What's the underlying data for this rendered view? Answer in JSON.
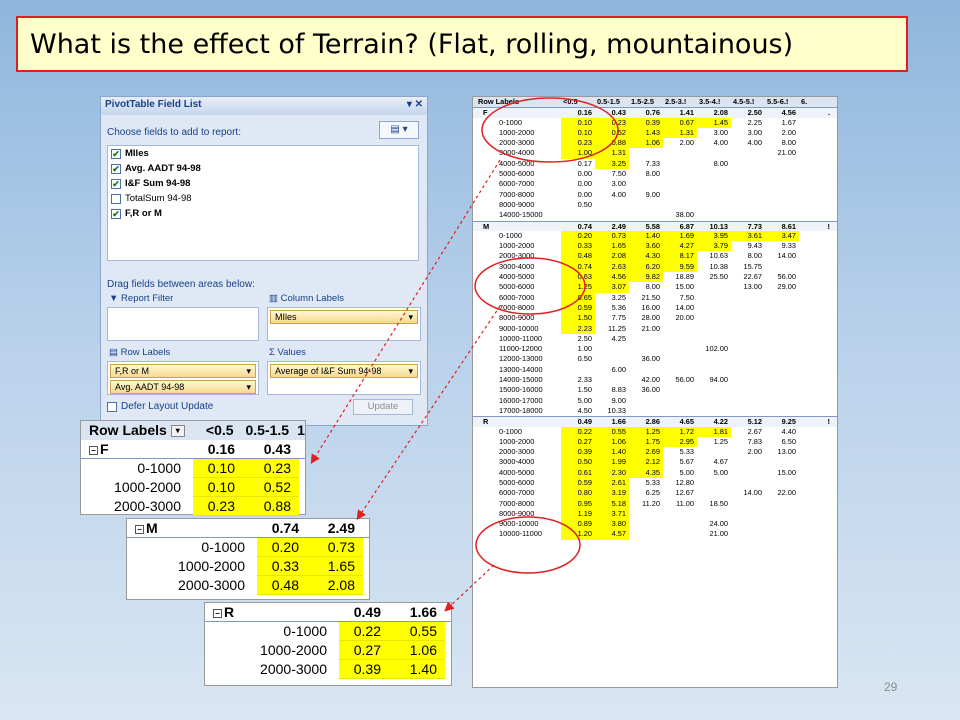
{
  "title": "What is the effect of Terrain? (Flat, rolling, mountainous)",
  "slide_number": "29",
  "field_list": {
    "header": "PivotTable Field List",
    "choose_label": "Choose fields to add to report:",
    "fields": [
      {
        "label": "MIles",
        "checked": "✔"
      },
      {
        "label": "Avg. AADT 94-98",
        "checked": "✔"
      },
      {
        "label": "I&F Sum 94-98",
        "checked": "✔"
      },
      {
        "label": "TotalSum 94-98",
        "checked": ""
      },
      {
        "label": "F,R or M",
        "checked": "✔"
      }
    ],
    "drag_label": "Drag fields between areas below:",
    "report_filter": "Report Filter",
    "column_labels": "Column Labels",
    "column_field": "MIles",
    "row_labels": "Row Labels",
    "values": "Values",
    "row_fields": [
      "F,R or M",
      "Avg. AADT 94-98"
    ],
    "value_field": "Average of I&F Sum 94-98",
    "defer_label": "Defer Layout Update",
    "update_label": "Update"
  },
  "big_table": {
    "header": [
      "Row Labels",
      "<0.5",
      "0.5-1.5",
      "1.5-2.5",
      "2.5-3.!",
      "3.5-4.!",
      "4.5-5.!",
      "5.5-6.!",
      "6."
    ],
    "rows": [
      {
        "label": "F",
        "type": "group",
        "cells": [
          "0.16",
          "0.43",
          "0.76",
          "1.41",
          "2.08",
          "2.50",
          "4.56",
          "."
        ],
        "yellow": [
          0,
          0,
          0,
          0,
          0,
          0,
          0,
          0
        ]
      },
      {
        "label": "0-1000",
        "type": "item",
        "cells": [
          "0.10",
          "0.23",
          "0.39",
          "0.67",
          "1.45",
          "2.25",
          "1.67",
          ""
        ],
        "yellow": [
          1,
          1,
          1,
          1,
          1,
          0,
          0,
          0
        ]
      },
      {
        "label": "1000-2000",
        "type": "item",
        "cells": [
          "0.10",
          "0.52",
          "1.43",
          "1.31",
          "3.00",
          "3.00",
          "2.00",
          ""
        ],
        "yellow": [
          1,
          1,
          1,
          1,
          0,
          0,
          0,
          0
        ]
      },
      {
        "label": "2000-3000",
        "type": "item",
        "cells": [
          "0.23",
          "0.88",
          "1.06",
          "2.00",
          "4.00",
          "4.00",
          "8.00",
          ""
        ],
        "yellow": [
          1,
          1,
          1,
          0,
          0,
          0,
          0,
          0
        ]
      },
      {
        "label": "3000-4000",
        "type": "item",
        "cells": [
          "1.00",
          "1.31",
          "",
          "",
          "",
          "",
          "21.00",
          ""
        ],
        "yellow": [
          1,
          1,
          0,
          0,
          0,
          0,
          0,
          0
        ]
      },
      {
        "label": "4000-5000",
        "type": "item",
        "cells": [
          "0.17",
          "3.25",
          "7.33",
          "",
          "8.00",
          "",
          "",
          ""
        ],
        "yellow": [
          0,
          1,
          0,
          0,
          0,
          0,
          0,
          0
        ]
      },
      {
        "label": "5000-6000",
        "type": "item",
        "cells": [
          "0.00",
          "7.50",
          "8.00",
          "",
          "",
          "",
          "",
          ""
        ],
        "yellow": [
          0,
          0,
          0,
          0,
          0,
          0,
          0,
          0
        ]
      },
      {
        "label": "6000-7000",
        "type": "item",
        "cells": [
          "0.00",
          "3.00",
          "",
          "",
          "",
          "",
          "",
          ""
        ],
        "yellow": [
          0,
          0,
          0,
          0,
          0,
          0,
          0,
          0
        ]
      },
      {
        "label": "7000-8000",
        "type": "item",
        "cells": [
          "0.00",
          "4.00",
          "9.00",
          "",
          "",
          "",
          "",
          ""
        ],
        "yellow": [
          0,
          0,
          0,
          0,
          0,
          0,
          0,
          0
        ]
      },
      {
        "label": "8000-9000",
        "type": "item",
        "cells": [
          "0.50",
          "",
          "",
          "",
          "",
          "",
          "",
          ""
        ],
        "yellow": [
          0,
          0,
          0,
          0,
          0,
          0,
          0,
          0
        ]
      },
      {
        "label": "14000-15000",
        "type": "item",
        "cells": [
          "",
          "",
          "",
          "38.00",
          "",
          "",
          "",
          ""
        ],
        "yellow": [
          0,
          0,
          0,
          0,
          0,
          0,
          0,
          0
        ]
      },
      {
        "label": "M",
        "type": "group",
        "cells": [
          "0.74",
          "2.49",
          "5.58",
          "6.87",
          "10.13",
          "7.73",
          "8.61",
          "!"
        ],
        "yellow": [
          0,
          0,
          0,
          0,
          0,
          0,
          0,
          0
        ]
      },
      {
        "label": "0-1000",
        "type": "item",
        "cells": [
          "0.20",
          "0.73",
          "1.40",
          "1.69",
          "3.95",
          "3.61",
          "3.47",
          ""
        ],
        "yellow": [
          1,
          1,
          1,
          1,
          1,
          1,
          1,
          0
        ]
      },
      {
        "label": "1000-2000",
        "type": "item",
        "cells": [
          "0.33",
          "1.65",
          "3.60",
          "4.27",
          "3.79",
          "9.43",
          "9.33",
          ""
        ],
        "yellow": [
          1,
          1,
          1,
          1,
          1,
          0,
          0,
          0
        ]
      },
      {
        "label": "2000-3000",
        "type": "item",
        "cells": [
          "0.48",
          "2.08",
          "4.30",
          "8.17",
          "10.63",
          "8.00",
          "14.00",
          ""
        ],
        "yellow": [
          1,
          1,
          1,
          1,
          0,
          0,
          0,
          0
        ]
      },
      {
        "label": "3000-4000",
        "type": "item",
        "cells": [
          "0.74",
          "2.63",
          "6.20",
          "9.59",
          "10.38",
          "15.75",
          "",
          ""
        ],
        "yellow": [
          1,
          1,
          1,
          1,
          0,
          0,
          0,
          0
        ]
      },
      {
        "label": "4000-5000",
        "type": "item",
        "cells": [
          "0.63",
          "4.56",
          "9.82",
          "18.89",
          "25.50",
          "22.67",
          "56.00",
          ""
        ],
        "yellow": [
          1,
          1,
          1,
          0,
          0,
          0,
          0,
          0
        ]
      },
      {
        "label": "5000-6000",
        "type": "item",
        "cells": [
          "1.25",
          "3.07",
          "8.00",
          "15.00",
          "",
          "13.00",
          "29.00",
          ""
        ],
        "yellow": [
          1,
          1,
          0,
          0,
          0,
          0,
          0,
          0
        ]
      },
      {
        "label": "6000-7000",
        "type": "item",
        "cells": [
          "0.65",
          "3.25",
          "21.50",
          "7.50",
          "",
          "",
          "",
          ""
        ],
        "yellow": [
          1,
          0,
          0,
          0,
          0,
          0,
          0,
          0
        ]
      },
      {
        "label": "7000-8000",
        "type": "item",
        "cells": [
          "0.59",
          "5.36",
          "16.00",
          "14.00",
          "",
          "",
          "",
          ""
        ],
        "yellow": [
          1,
          0,
          0,
          0,
          0,
          0,
          0,
          0
        ]
      },
      {
        "label": "8000-9000",
        "type": "item",
        "cells": [
          "1.50",
          "7.75",
          "28.00",
          "20.00",
          "",
          "",
          "",
          ""
        ],
        "yellow": [
          1,
          0,
          0,
          0,
          0,
          0,
          0,
          0
        ]
      },
      {
        "label": "9000-10000",
        "type": "item",
        "cells": [
          "2.23",
          "11.25",
          "21.00",
          "",
          "",
          "",
          "",
          ""
        ],
        "yellow": [
          1,
          0,
          0,
          0,
          0,
          0,
          0,
          0
        ]
      },
      {
        "label": "10000-11000",
        "type": "item",
        "cells": [
          "2.50",
          "4.25",
          "",
          "",
          "",
          "",
          "",
          ""
        ],
        "yellow": [
          0,
          0,
          0,
          0,
          0,
          0,
          0,
          0
        ]
      },
      {
        "label": "11000-12000",
        "type": "item",
        "cells": [
          "1.00",
          "",
          "",
          "",
          "102.00",
          "",
          "",
          ""
        ],
        "yellow": [
          0,
          0,
          0,
          0,
          0,
          0,
          0,
          0
        ]
      },
      {
        "label": "12000-13000",
        "type": "item",
        "cells": [
          "0.50",
          "",
          "36.00",
          "",
          "",
          "",
          "",
          ""
        ],
        "yellow": [
          0,
          0,
          0,
          0,
          0,
          0,
          0,
          0
        ]
      },
      {
        "label": "13000-14000",
        "type": "item",
        "cells": [
          "",
          "6.00",
          "",
          "",
          "",
          "",
          "",
          ""
        ],
        "yellow": [
          0,
          0,
          0,
          0,
          0,
          0,
          0,
          0
        ]
      },
      {
        "label": "14000-15000",
        "type": "item",
        "cells": [
          "2.33",
          "",
          "42.00",
          "56.00",
          "94.00",
          "",
          "",
          ""
        ],
        "yellow": [
          0,
          0,
          0,
          0,
          0,
          0,
          0,
          0
        ]
      },
      {
        "label": "15000-16000",
        "type": "item",
        "cells": [
          "1.50",
          "8.83",
          "36.00",
          "",
          "",
          "",
          "",
          ""
        ],
        "yellow": [
          0,
          0,
          0,
          0,
          0,
          0,
          0,
          0
        ]
      },
      {
        "label": "16000-17000",
        "type": "item",
        "cells": [
          "5.00",
          "9.00",
          "",
          "",
          "",
          "",
          "",
          ""
        ],
        "yellow": [
          0,
          0,
          0,
          0,
          0,
          0,
          0,
          0
        ]
      },
      {
        "label": "17000-18000",
        "type": "item",
        "cells": [
          "4.50",
          "10.33",
          "",
          "",
          "",
          "",
          "",
          ""
        ],
        "yellow": [
          0,
          0,
          0,
          0,
          0,
          0,
          0,
          0
        ]
      },
      {
        "label": "R",
        "type": "group",
        "cells": [
          "0.49",
          "1.66",
          "2.86",
          "4.65",
          "4.22",
          "5.12",
          "9.25",
          "!"
        ],
        "yellow": [
          0,
          0,
          0,
          0,
          0,
          0,
          0,
          0
        ]
      },
      {
        "label": "0-1000",
        "type": "item",
        "cells": [
          "0.22",
          "0.55",
          "1.25",
          "1.72",
          "1.81",
          "2.67",
          "4.40",
          ""
        ],
        "yellow": [
          1,
          1,
          1,
          1,
          1,
          0,
          0,
          0
        ]
      },
      {
        "label": "1000-2000",
        "type": "item",
        "cells": [
          "0.27",
          "1.06",
          "1.75",
          "2.95",
          "1.25",
          "7.83",
          "6.50",
          ""
        ],
        "yellow": [
          1,
          1,
          1,
          1,
          0,
          0,
          0,
          0
        ]
      },
      {
        "label": "2000-3000",
        "type": "item",
        "cells": [
          "0.39",
          "1.40",
          "2.69",
          "5.33",
          "",
          "2.00",
          "13.00",
          ""
        ],
        "yellow": [
          1,
          1,
          1,
          0,
          0,
          0,
          0,
          0
        ]
      },
      {
        "label": "3000-4000",
        "type": "item",
        "cells": [
          "0.50",
          "1.99",
          "2.12",
          "5.67",
          "4.67",
          "",
          "",
          ""
        ],
        "yellow": [
          1,
          1,
          1,
          0,
          0,
          0,
          0,
          0
        ]
      },
      {
        "label": "4000-5000",
        "type": "item",
        "cells": [
          "0.61",
          "2.30",
          "4.35",
          "5.00",
          "5.00",
          "",
          "15.00",
          ""
        ],
        "yellow": [
          1,
          1,
          1,
          0,
          0,
          0,
          0,
          0
        ]
      },
      {
        "label": "5000-6000",
        "type": "item",
        "cells": [
          "0.59",
          "2.61",
          "5.33",
          "12.80",
          "",
          "",
          "",
          ""
        ],
        "yellow": [
          1,
          1,
          0,
          0,
          0,
          0,
          0,
          0
        ]
      },
      {
        "label": "6000-7000",
        "type": "item",
        "cells": [
          "0.80",
          "3.19",
          "6.25",
          "12.67",
          "",
          "14.00",
          "22.00",
          ""
        ],
        "yellow": [
          1,
          1,
          0,
          0,
          0,
          0,
          0,
          0
        ]
      },
      {
        "label": "7000-8000",
        "type": "item",
        "cells": [
          "0.95",
          "5.18",
          "11.20",
          "11.00",
          "18.50",
          "",
          "",
          ""
        ],
        "yellow": [
          1,
          1,
          0,
          0,
          0,
          0,
          0,
          0
        ]
      },
      {
        "label": "8000-9000",
        "type": "item",
        "cells": [
          "1.19",
          "3.71",
          "",
          "",
          "",
          "",
          "",
          ""
        ],
        "yellow": [
          1,
          1,
          0,
          0,
          0,
          0,
          0,
          0
        ]
      },
      {
        "label": "9000-10000",
        "type": "item",
        "cells": [
          "0.89",
          "3.80",
          "",
          "",
          "24.00",
          "",
          "",
          ""
        ],
        "yellow": [
          1,
          1,
          0,
          0,
          0,
          0,
          0,
          0
        ]
      },
      {
        "label": "10000-11000",
        "type": "item",
        "cells": [
          "1.20",
          "4.57",
          "",
          "",
          "21.00",
          "",
          "",
          ""
        ],
        "yellow": [
          1,
          1,
          0,
          0,
          0,
          0,
          0,
          0
        ]
      }
    ]
  },
  "zoom_f": {
    "header": [
      "Row Labels",
      "<0.5",
      "0.5-1.5",
      "1"
    ],
    "group": {
      "label": "F",
      "values": [
        "0.16",
        "0.43"
      ]
    },
    "rows": [
      {
        "label": "0-1000",
        "values": [
          "0.10",
          "0.23"
        ]
      },
      {
        "label": "1000-2000",
        "values": [
          "0.10",
          "0.52"
        ]
      },
      {
        "label": "2000-3000",
        "values": [
          "0.23",
          "0.88"
        ]
      }
    ]
  },
  "zoom_m": {
    "group": {
      "label": "M",
      "values": [
        "0.74",
        "2.49"
      ]
    },
    "rows": [
      {
        "label": "0-1000",
        "values": [
          "0.20",
          "0.73"
        ]
      },
      {
        "label": "1000-2000",
        "values": [
          "0.33",
          "1.65"
        ]
      },
      {
        "label": "2000-3000",
        "values": [
          "0.48",
          "2.08"
        ]
      }
    ]
  },
  "zoom_r": {
    "group": {
      "label": "R",
      "values": [
        "0.49",
        "1.66"
      ]
    },
    "rows": [
      {
        "label": "0-1000",
        "values": [
          "0.22",
          "0.55"
        ]
      },
      {
        "label": "1000-2000",
        "values": [
          "0.27",
          "1.06"
        ]
      },
      {
        "label": "2000-3000",
        "values": [
          "0.39",
          "1.40"
        ]
      }
    ]
  },
  "colors": {
    "highlight": "#ffff00",
    "annotation_red": "#e02020",
    "title_bg": "#ffffcc"
  }
}
